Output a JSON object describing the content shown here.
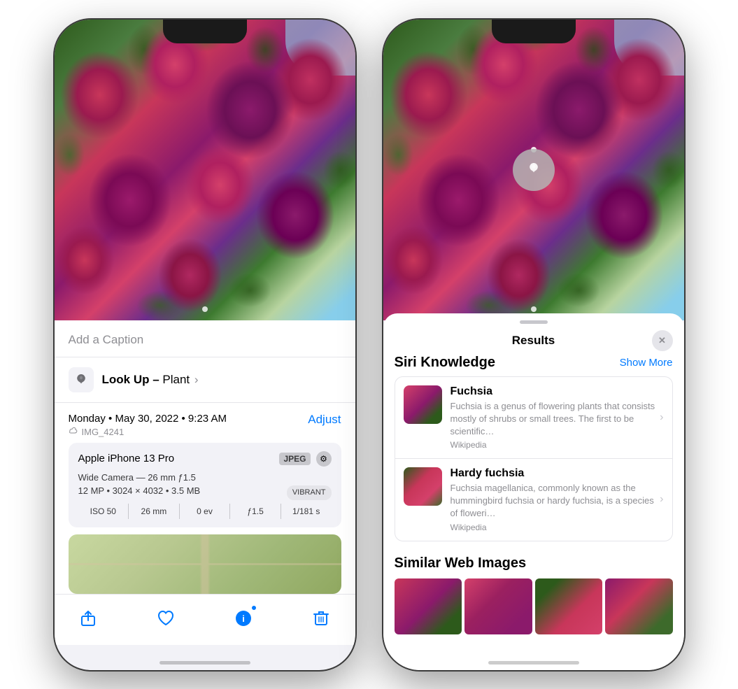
{
  "phone1": {
    "caption_placeholder": "Add a Caption",
    "lookup_label": "Look Up –",
    "lookup_subject": " Plant",
    "date_main": "Monday • May 30, 2022 • 9:23 AM",
    "date_adjust": "Adjust",
    "filename": "IMG_4241",
    "device_name": "Apple iPhone 13 Pro",
    "badge_jpeg": "JPEG",
    "camera_spec1": "Wide Camera — 26 mm ƒ1.5",
    "camera_spec2": "12 MP • 3024 × 4032 • 3.5 MB",
    "vibrant": "VIBRANT",
    "exif": [
      {
        "label": "ISO 50"
      },
      {
        "label": "26 mm"
      },
      {
        "label": "0 ev"
      },
      {
        "label": "ƒ1.5"
      },
      {
        "label": "1/181 s"
      }
    ]
  },
  "phone2": {
    "results_title": "Results",
    "siri_knowledge_title": "Siri Knowledge",
    "show_more": "Show More",
    "items": [
      {
        "name": "Fuchsia",
        "desc": "Fuchsia is a genus of flowering plants that consists mostly of shrubs or small trees. The first to be scientific…",
        "source": "Wikipedia"
      },
      {
        "name": "Hardy fuchsia",
        "desc": "Fuchsia magellanica, commonly known as the hummingbird fuchsia or hardy fuchsia, is a species of floweri…",
        "source": "Wikipedia"
      }
    ],
    "similar_title": "Similar Web Images"
  }
}
